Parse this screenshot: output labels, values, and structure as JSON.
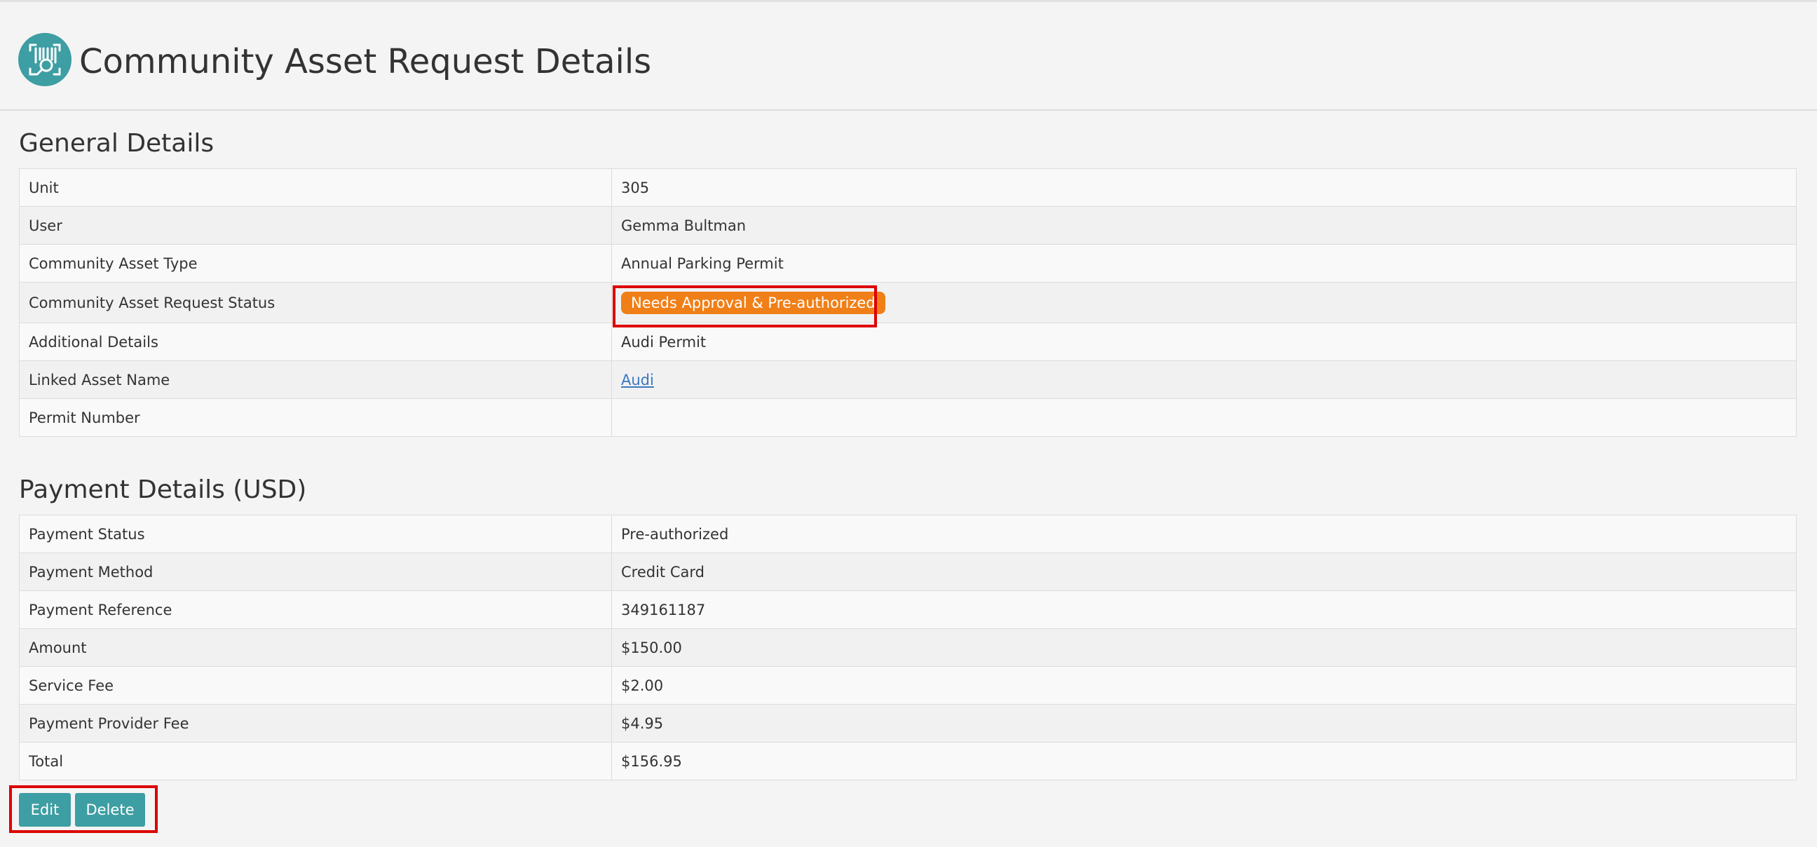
{
  "header": {
    "title": "Community Asset Request Details",
    "logo_icon": "barcode-scan-icon",
    "logo_color": "#3d9ea3"
  },
  "general": {
    "title": "General Details",
    "rows": [
      {
        "label": "Unit",
        "value": "305"
      },
      {
        "label": "User",
        "value": "Gemma Bultman"
      },
      {
        "label": "Community Asset Type",
        "value": "Annual Parking Permit"
      },
      {
        "label": "Community Asset Request Status",
        "value": "Needs Approval & Pre-authorized"
      },
      {
        "label": "Additional Details",
        "value": "Audi Permit"
      },
      {
        "label": "Linked Asset Name",
        "value": "Audi"
      },
      {
        "label": "Permit Number",
        "value": ""
      }
    ],
    "status_badge_color": "#f07f17",
    "link_color": "#3a78c0"
  },
  "payment": {
    "title": "Payment Details (USD)",
    "rows": [
      {
        "label": "Payment Status",
        "value": "Pre-authorized"
      },
      {
        "label": "Payment Method",
        "value": "Credit Card"
      },
      {
        "label": "Payment Reference",
        "value": "349161187"
      },
      {
        "label": "Amount",
        "value": "$150.00"
      },
      {
        "label": "Service Fee",
        "value": "$2.00"
      },
      {
        "label": "Payment Provider Fee",
        "value": "$4.95"
      },
      {
        "label": "Total",
        "value": "$156.95"
      }
    ]
  },
  "actions": {
    "edit_label": "Edit",
    "delete_label": "Delete",
    "button_color": "#3d9ea3"
  },
  "highlight_color": "#dd0000"
}
